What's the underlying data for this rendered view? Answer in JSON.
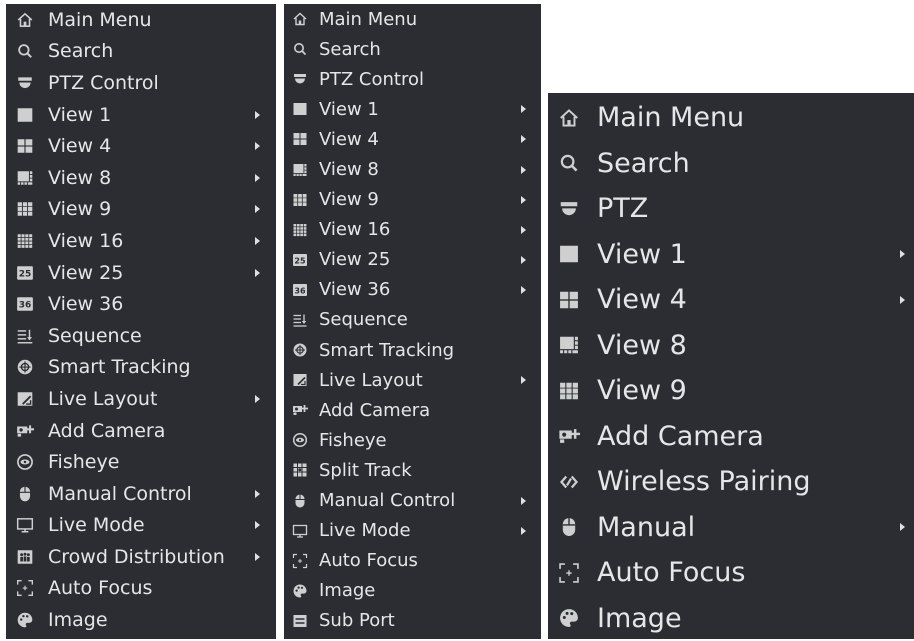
{
  "menu_left": {
    "items": [
      {
        "label": "Main Menu",
        "icon": "home-icon",
        "submenu": false
      },
      {
        "label": "Search",
        "icon": "search-icon",
        "submenu": false
      },
      {
        "label": "PTZ Control",
        "icon": "ptz-dome-icon",
        "submenu": false
      },
      {
        "label": "View 1",
        "icon": "view-1-icon",
        "submenu": true
      },
      {
        "label": "View 4",
        "icon": "view-4-icon",
        "submenu": true
      },
      {
        "label": "View 8",
        "icon": "view-8-icon",
        "submenu": true
      },
      {
        "label": "View 9",
        "icon": "view-9-icon",
        "submenu": true
      },
      {
        "label": "View 16",
        "icon": "view-16-icon",
        "submenu": true
      },
      {
        "label": "View 25",
        "icon": "view-25-icon",
        "submenu": true
      },
      {
        "label": "View 36",
        "icon": "view-36-icon",
        "submenu": false
      },
      {
        "label": "Sequence",
        "icon": "sequence-icon",
        "submenu": false
      },
      {
        "label": "Smart Tracking",
        "icon": "smart-tracking-icon",
        "submenu": false
      },
      {
        "label": "Live Layout",
        "icon": "live-layout-icon",
        "submenu": true
      },
      {
        "label": "Add Camera",
        "icon": "add-camera-icon",
        "submenu": false
      },
      {
        "label": "Fisheye",
        "icon": "fisheye-icon",
        "submenu": false
      },
      {
        "label": "Manual Control",
        "icon": "mouse-icon",
        "submenu": true
      },
      {
        "label": "Live Mode",
        "icon": "monitor-icon",
        "submenu": true
      },
      {
        "label": "Crowd Distribution",
        "icon": "crowd-icon",
        "submenu": true
      },
      {
        "label": "Auto Focus",
        "icon": "auto-focus-icon",
        "submenu": false
      },
      {
        "label": "Image",
        "icon": "image-palette-icon",
        "submenu": false
      }
    ]
  },
  "menu_middle": {
    "items": [
      {
        "label": "Main Menu",
        "icon": "home-icon",
        "submenu": false
      },
      {
        "label": "Search",
        "icon": "search-icon",
        "submenu": false
      },
      {
        "label": "PTZ Control",
        "icon": "ptz-dome-icon",
        "submenu": false
      },
      {
        "label": "View 1",
        "icon": "view-1-icon",
        "submenu": true
      },
      {
        "label": "View 4",
        "icon": "view-4-icon",
        "submenu": true
      },
      {
        "label": "View 8",
        "icon": "view-8-icon",
        "submenu": true
      },
      {
        "label": "View 9",
        "icon": "view-9-icon",
        "submenu": true
      },
      {
        "label": "View 16",
        "icon": "view-16-icon",
        "submenu": true
      },
      {
        "label": "View 25",
        "icon": "view-25-icon",
        "submenu": true
      },
      {
        "label": "View 36",
        "icon": "view-36-icon",
        "submenu": true
      },
      {
        "label": "Sequence",
        "icon": "sequence-icon",
        "submenu": false
      },
      {
        "label": "Smart Tracking",
        "icon": "smart-tracking-icon",
        "submenu": false
      },
      {
        "label": "Live Layout",
        "icon": "live-layout-icon",
        "submenu": true
      },
      {
        "label": "Add Camera",
        "icon": "add-camera-icon",
        "submenu": false
      },
      {
        "label": "Fisheye",
        "icon": "fisheye-icon",
        "submenu": false
      },
      {
        "label": "Split Track",
        "icon": "split-track-icon",
        "submenu": false
      },
      {
        "label": "Manual Control",
        "icon": "mouse-icon",
        "submenu": true
      },
      {
        "label": "Live Mode",
        "icon": "monitor-icon",
        "submenu": true
      },
      {
        "label": "Auto Focus",
        "icon": "auto-focus-icon",
        "submenu": false
      },
      {
        "label": "Image",
        "icon": "image-palette-icon",
        "submenu": false
      },
      {
        "label": "Sub Port",
        "icon": "sub-port-icon",
        "submenu": false
      }
    ]
  },
  "menu_right": {
    "items": [
      {
        "label": "Main Menu",
        "icon": "home-icon",
        "submenu": false
      },
      {
        "label": "Search",
        "icon": "search-icon",
        "submenu": false
      },
      {
        "label": "PTZ",
        "icon": "ptz-dome-icon",
        "submenu": false
      },
      {
        "label": "View 1",
        "icon": "view-1-icon",
        "submenu": true
      },
      {
        "label": "View 4",
        "icon": "view-4-icon",
        "submenu": true
      },
      {
        "label": "View 8",
        "icon": "view-8-icon",
        "submenu": false
      },
      {
        "label": "View 9",
        "icon": "view-9-icon",
        "submenu": false
      },
      {
        "label": "Add Camera",
        "icon": "add-camera-icon",
        "submenu": false
      },
      {
        "label": "Wireless Pairing",
        "icon": "wireless-pairing-icon",
        "submenu": false
      },
      {
        "label": "Manual",
        "icon": "mouse-icon",
        "submenu": true
      },
      {
        "label": "Auto Focus",
        "icon": "auto-focus-icon",
        "submenu": false
      },
      {
        "label": "Image",
        "icon": "image-palette-icon",
        "submenu": false
      }
    ]
  },
  "colors": {
    "menu_bg": "#2b2d33",
    "text": "#e6e6e6",
    "icon": "#cfcfcf",
    "page_bg": "#ffffff"
  }
}
